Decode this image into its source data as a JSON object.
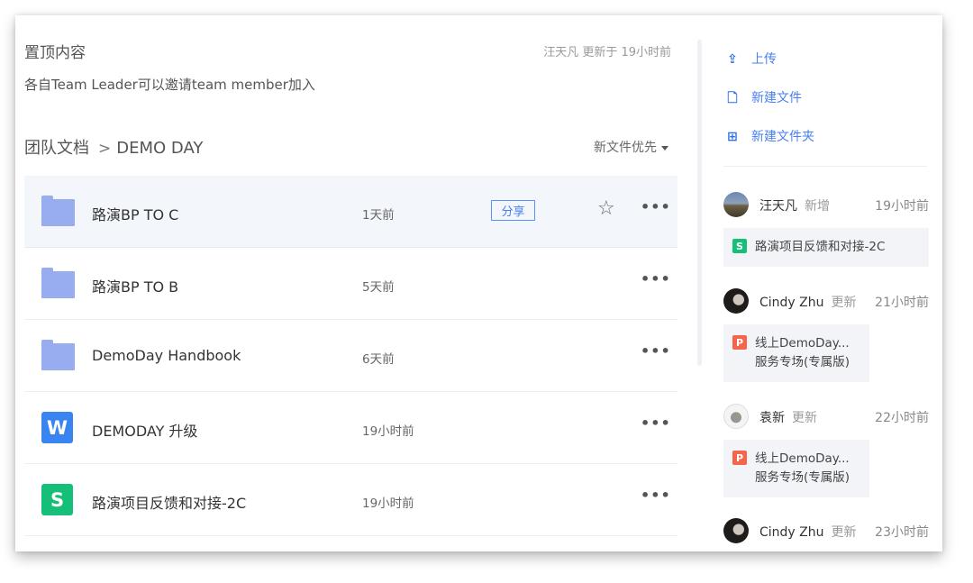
{
  "pinned": {
    "title": "置顶内容",
    "meta": "汪天凡 更新于 19小时前",
    "description": "各自Team Leader可以邀请team member加入"
  },
  "breadcrumb": {
    "root": "团队文档",
    "separator": ">",
    "current": "DEMO DAY"
  },
  "sort": {
    "label": "新文件优先"
  },
  "files": [
    {
      "type": "folder",
      "icon": "folder-icon",
      "name": "路演BP TO C",
      "time": "1天前",
      "share_label": "分享",
      "highlighted": true
    },
    {
      "type": "folder",
      "icon": "folder-icon",
      "name": "路演BP TO B",
      "time": "5天前"
    },
    {
      "type": "folder",
      "icon": "folder-icon",
      "name": "DemoDay Handbook",
      "time": "6天前"
    },
    {
      "type": "word",
      "icon": "word-doc-icon",
      "badge": "W",
      "name": "DEMODAY 升级",
      "time": "19小时前"
    },
    {
      "type": "sheet",
      "icon": "sheet-doc-icon",
      "badge": "S",
      "name": "路演项目反馈和对接-2C",
      "time": "19小时前"
    }
  ],
  "actions": [
    {
      "icon": "upload-icon",
      "label": "上传"
    },
    {
      "icon": "new-file-icon",
      "label": "新建文件"
    },
    {
      "icon": "new-folder-icon",
      "label": "新建文件夹"
    }
  ],
  "activities": [
    {
      "user": "汪天凡",
      "verb": "新增",
      "time": "19小时前",
      "file_badge": "S",
      "file_name": "路演项目反馈和对接-2C"
    },
    {
      "user": "Cindy Zhu",
      "verb": "更新",
      "time": "21小时前",
      "file_badge": "P",
      "file_name": "线上DemoDay...服务专场(专属版)"
    },
    {
      "user": "袁新",
      "verb": "更新",
      "time": "22小时前",
      "file_badge": "P",
      "file_name": "线上DemoDay...服务专场(专属版)"
    },
    {
      "user": "Cindy Zhu",
      "verb": "更新",
      "time": "23小时前"
    }
  ],
  "colors": {
    "accent": "#4a7ff0",
    "folder": "#97adf0",
    "word": "#3a84f2",
    "sheet": "#16bf78",
    "ppt": "#f3664a"
  }
}
